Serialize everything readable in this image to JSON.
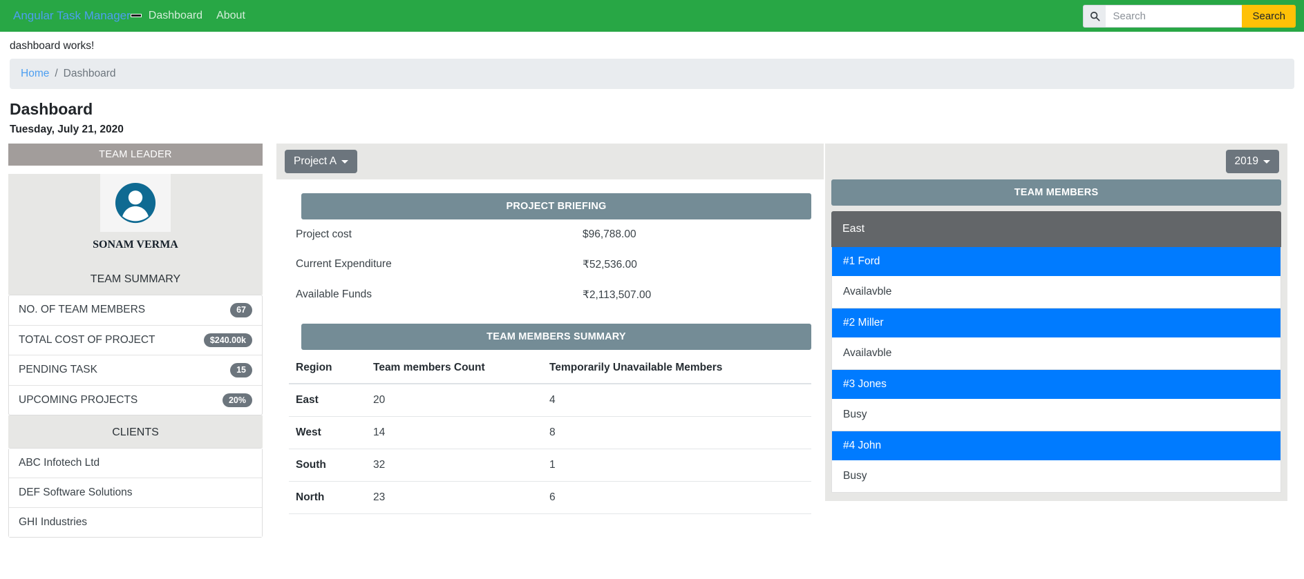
{
  "navbar": {
    "brand": "Angular Task Manager",
    "toggle_icon": "hamburger-icon",
    "links": [
      {
        "label": "Dashboard"
      },
      {
        "label": "About"
      }
    ],
    "search": {
      "icon": "search-icon",
      "placeholder": "Search",
      "value": "",
      "button_label": "Search"
    },
    "bg_color": "#28a745",
    "search_button_color": "#ffc107"
  },
  "content": {
    "works_text": "dashboard works!",
    "breadcrumb": {
      "home": "Home",
      "separator": "/",
      "current": "Dashboard"
    },
    "page_title": "Dashboard",
    "page_date": "Tuesday, July 21, 2020"
  },
  "sidebar": {
    "leader_panel_title": "TEAM LEADER",
    "avatar_icon": "user-avatar-icon",
    "leader_name": "SONAM VERMA",
    "team_summary_title": "TEAM SUMMARY",
    "summary_items": [
      {
        "label": "NO. OF TEAM MEMBERS",
        "badge": "67"
      },
      {
        "label": "TOTAL COST OF PROJECT",
        "badge": "$240.00k"
      },
      {
        "label": "PENDING TASK",
        "badge": "15"
      },
      {
        "label": "UPCOMING PROJECTS",
        "badge": "20%"
      }
    ],
    "clients_title": "CLIENTS",
    "clients": [
      {
        "name": "ABC Infotech Ltd"
      },
      {
        "name": "DEF Software Solutions"
      },
      {
        "name": "GHI Industries"
      }
    ]
  },
  "main": {
    "project_dropdown": {
      "label": "Project A",
      "icon": "chevron-down-icon"
    },
    "briefing": {
      "title": "PROJECT BRIEFING",
      "rows": [
        {
          "key": "Project cost",
          "value": "$96,788.00"
        },
        {
          "key": "Current Expenditure",
          "value": "₹52,536.00"
        },
        {
          "key": "Available Funds",
          "value": "₹2,113,507.00"
        }
      ]
    },
    "team_summary_table": {
      "title": "TEAM MEMBERS SUMMARY",
      "columns": [
        "Region",
        "Team members Count",
        "Temporarily Unavailable Members"
      ],
      "rows": [
        {
          "region": "East",
          "count": "20",
          "unavailable": "4"
        },
        {
          "region": "West",
          "count": "14",
          "unavailable": "8"
        },
        {
          "region": "South",
          "count": "32",
          "unavailable": "1"
        },
        {
          "region": "North",
          "count": "23",
          "unavailable": "6"
        }
      ]
    }
  },
  "right": {
    "year_dropdown": {
      "label": "2019",
      "icon": "chevron-down-icon"
    },
    "panel_title": "TEAM MEMBERS",
    "region_label": "East",
    "members": [
      {
        "name": "#1 Ford",
        "status": "Availavble"
      },
      {
        "name": "#2 Miller",
        "status": "Availavble"
      },
      {
        "name": "#3 Jones",
        "status": "Busy"
      },
      {
        "name": "#4 John",
        "status": "Busy"
      }
    ],
    "accent_color": "#007bff"
  }
}
